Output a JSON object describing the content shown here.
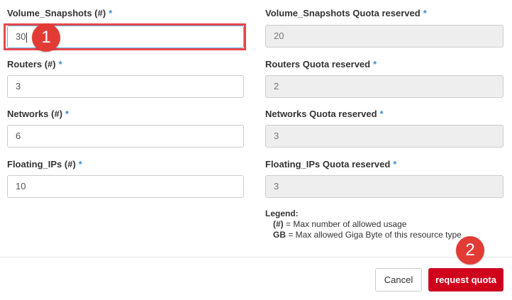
{
  "form": {
    "left": [
      {
        "label": "Volume_Snapshots (#)",
        "value": "30"
      },
      {
        "label": "Routers (#)",
        "value": "3"
      },
      {
        "label": "Networks (#)",
        "value": "6"
      },
      {
        "label": "Floating_IPs (#)",
        "value": "10"
      }
    ],
    "right": [
      {
        "label": "Volume_Snapshots Quota reserved",
        "value": "20"
      },
      {
        "label": "Routers Quota reserved",
        "value": "2"
      },
      {
        "label": "Networks Quota reserved",
        "value": "3"
      },
      {
        "label": "Floating_IPs Quota reserved",
        "value": "3"
      }
    ],
    "required_marker": "*"
  },
  "legend": {
    "title": "Legend:",
    "items": [
      {
        "key": "(#)",
        "text": " = Max number of allowed usage"
      },
      {
        "key": "GB",
        "text": " = Max allowed Giga Byte of this resource type"
      }
    ]
  },
  "buttons": {
    "cancel": "Cancel",
    "request": "request quota"
  },
  "markers": {
    "step1": "1",
    "step2": "2"
  },
  "colors": {
    "accent": "#d0021b",
    "marker": "#e23b36",
    "highlight": "#e8474c",
    "required": "#3b8ed6"
  }
}
